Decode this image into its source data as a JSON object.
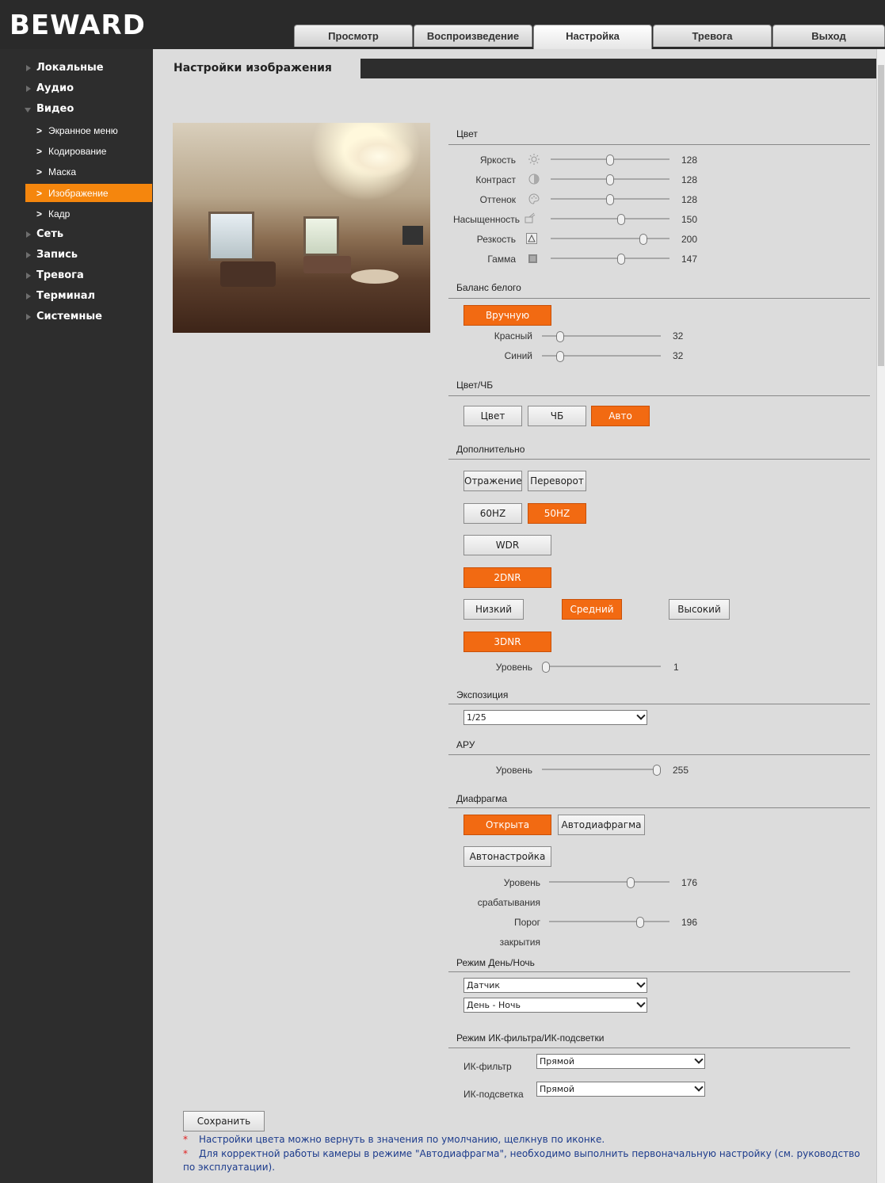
{
  "brand": "BEWARD",
  "tabs": [
    {
      "label": "Просмотр"
    },
    {
      "label": "Воспроизведение"
    },
    {
      "label": "Настройка"
    },
    {
      "label": "Тревога"
    },
    {
      "label": "Выход"
    }
  ],
  "sidebar": {
    "items": [
      {
        "label": "Локальные"
      },
      {
        "label": "Аудио"
      },
      {
        "label": "Видео"
      },
      {
        "label": "Экранное меню"
      },
      {
        "label": "Кодирование"
      },
      {
        "label": "Маска"
      },
      {
        "label": "Изображение"
      },
      {
        "label": "Кадр"
      },
      {
        "label": "Сеть"
      },
      {
        "label": "Запись"
      },
      {
        "label": "Тревога"
      },
      {
        "label": "Терминал"
      },
      {
        "label": "Системные"
      }
    ]
  },
  "page": {
    "title": "Настройки изображения"
  },
  "color": {
    "section": "Цвет",
    "rows": [
      {
        "label": "Яркость",
        "value": "128",
        "icon": "sun-icon"
      },
      {
        "label": "Контраст",
        "value": "128",
        "icon": "contrast-icon"
      },
      {
        "label": "Оттенок",
        "value": "128",
        "icon": "palette-icon"
      },
      {
        "label": "Насыщенность",
        "value": "150",
        "icon": "saturation-icon"
      },
      {
        "label": "Резкость",
        "value": "200",
        "icon": "sharpness-icon"
      },
      {
        "label": "Гамма",
        "value": "147",
        "icon": "gamma-icon"
      }
    ]
  },
  "wb": {
    "section": "Баланс белого",
    "mode": "Вручную",
    "red_label": "Красный",
    "red_value": "32",
    "blue_label": "Синий",
    "blue_value": "32"
  },
  "colorbw": {
    "section": "Цвет/ЧБ",
    "color": "Цвет",
    "bw": "ЧБ",
    "auto": "Авто"
  },
  "extra": {
    "section": "Дополнительно",
    "mirror": "Отражение",
    "flip": "Переворот",
    "hz60": "60HZ",
    "hz50": "50HZ",
    "wdr": "WDR",
    "dnr2": "2DNR",
    "low": "Низкий",
    "mid": "Средний",
    "high": "Высокий",
    "dnr3": "3DNR",
    "level_label": "Уровень",
    "level_value": "1"
  },
  "exposure": {
    "section": "Экспозиция",
    "value": "1/25"
  },
  "agc": {
    "section": "АРУ",
    "level_label": "Уровень",
    "level_value": "255"
  },
  "iris": {
    "section": "Диафрагма",
    "open": "Открыта",
    "auto": "Автодиафрагма",
    "autotune": "Автонастройка",
    "trigger_label_1": "Уровень",
    "trigger_label_2": "срабатывания",
    "trigger_value": "176",
    "close_label_1": "Порог",
    "close_label_2": "закрытия",
    "close_value": "196"
  },
  "daynight": {
    "section": "Режим День/Ночь",
    "sensor": "Датчик",
    "mode": "День - Ночь"
  },
  "ir": {
    "section": "Режим ИК-фильтра/ИК-подсветки",
    "filter_label": "ИК-фильтр",
    "filter_value": "Прямой",
    "light_label": "ИК-подсветка",
    "light_value": "Прямой"
  },
  "save": "Сохранить",
  "notes": {
    "n1": "Настройки цвета можно вернуть в значения по умолчанию, щелкнув по иконке.",
    "n2a": "Для корректной работы камеры в режиме \"Автодиафрагма\", необходимо выполнить первоначальную настройку (см. руководство",
    "n2b": "по эксплуатации)."
  },
  "colors": {
    "accent": "#f26a12",
    "sidebar": "#2d2d2d",
    "content": "#dcdcdc",
    "note": "#1c3b8c"
  }
}
